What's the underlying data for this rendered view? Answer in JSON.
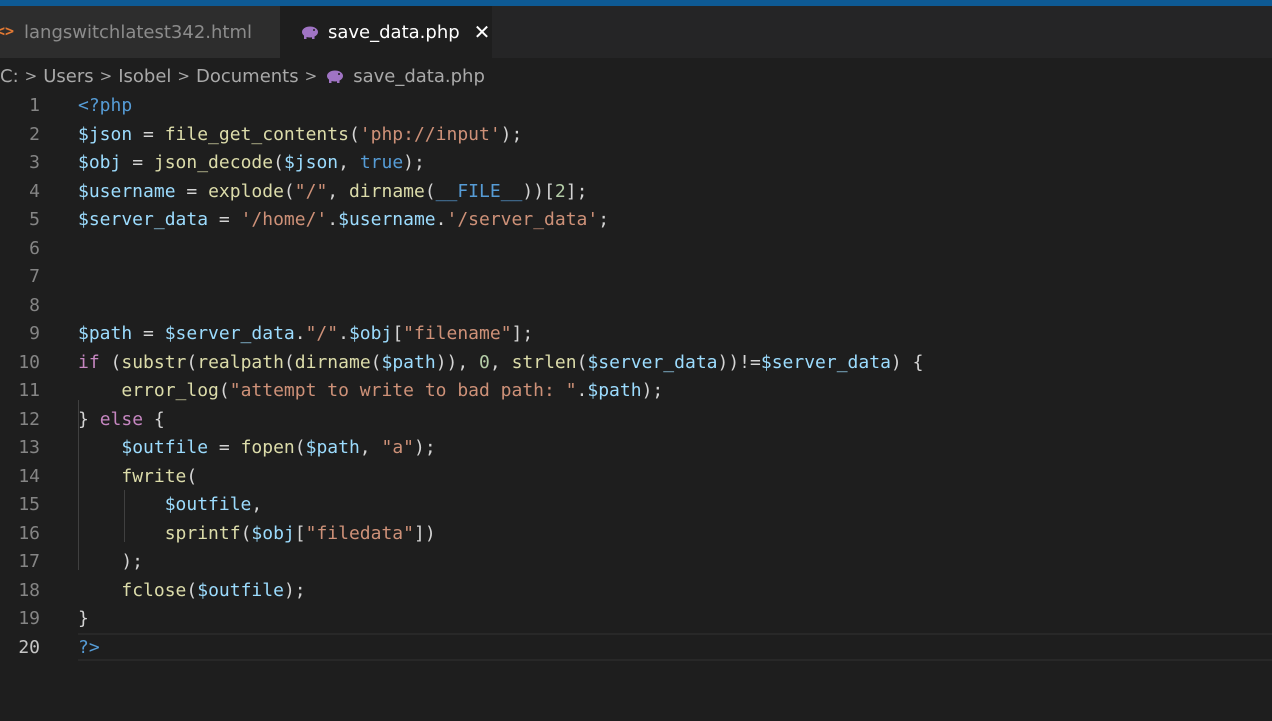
{
  "tabs": [
    {
      "label": "langswitchlatest342.html",
      "active": false,
      "icon": "html-icon"
    },
    {
      "label": "save_data.php",
      "active": true,
      "icon": "php-elephant-icon"
    }
  ],
  "breadcrumb": [
    "C:",
    "Users",
    "Isobel",
    "Documents",
    "save_data.php"
  ],
  "colors": {
    "accent": "#0e5a94",
    "variable": "#9cdcfe",
    "function": "#dcdcaa",
    "string": "#ce9178",
    "keyword": "#569cd6",
    "control": "#c586c0"
  },
  "lines": [
    {
      "n": "1",
      "tokens": [
        [
          "t",
          "<?php"
        ]
      ]
    },
    {
      "n": "2",
      "tokens": [
        [
          "v",
          "$json"
        ],
        [
          "p",
          " = "
        ],
        [
          "f",
          "file_get_contents"
        ],
        [
          "p",
          "("
        ],
        [
          "s",
          "'php://input'"
        ],
        [
          "p",
          ");"
        ]
      ]
    },
    {
      "n": "3",
      "tokens": [
        [
          "v",
          "$obj"
        ],
        [
          "p",
          " = "
        ],
        [
          "f",
          "json_decode"
        ],
        [
          "p",
          "("
        ],
        [
          "v",
          "$json"
        ],
        [
          "p",
          ", "
        ],
        [
          "k",
          "true"
        ],
        [
          "p",
          ");"
        ]
      ]
    },
    {
      "n": "4",
      "tokens": [
        [
          "v",
          "$username"
        ],
        [
          "p",
          " = "
        ],
        [
          "f",
          "explode"
        ],
        [
          "p",
          "("
        ],
        [
          "s",
          "\"/\""
        ],
        [
          "p",
          ", "
        ],
        [
          "f",
          "dirname"
        ],
        [
          "p",
          "("
        ],
        [
          "k",
          "__FILE__"
        ],
        [
          "p",
          "))["
        ],
        [
          "n",
          "2"
        ],
        [
          "p",
          "];"
        ]
      ]
    },
    {
      "n": "5",
      "tokens": [
        [
          "v",
          "$server_data"
        ],
        [
          "p",
          " = "
        ],
        [
          "s",
          "'/home/'"
        ],
        [
          "p",
          "."
        ],
        [
          "v",
          "$username"
        ],
        [
          "p",
          "."
        ],
        [
          "s",
          "'/server_data'"
        ],
        [
          "p",
          ";"
        ]
      ]
    },
    {
      "n": "6",
      "tokens": []
    },
    {
      "n": "7",
      "tokens": []
    },
    {
      "n": "8",
      "tokens": []
    },
    {
      "n": "9",
      "tokens": [
        [
          "v",
          "$path"
        ],
        [
          "p",
          " = "
        ],
        [
          "v",
          "$server_data"
        ],
        [
          "p",
          "."
        ],
        [
          "s",
          "\"/\""
        ],
        [
          "p",
          "."
        ],
        [
          "v",
          "$obj"
        ],
        [
          "p",
          "["
        ],
        [
          "s",
          "\"filename\""
        ],
        [
          "p",
          "];"
        ]
      ]
    },
    {
      "n": "10",
      "tokens": [
        [
          "c",
          "if"
        ],
        [
          "p",
          " ("
        ],
        [
          "f",
          "substr"
        ],
        [
          "p",
          "("
        ],
        [
          "f",
          "realpath"
        ],
        [
          "p",
          "("
        ],
        [
          "f",
          "dirname"
        ],
        [
          "p",
          "("
        ],
        [
          "v",
          "$path"
        ],
        [
          "p",
          ")), "
        ],
        [
          "n",
          "0"
        ],
        [
          "p",
          ", "
        ],
        [
          "f",
          "strlen"
        ],
        [
          "p",
          "("
        ],
        [
          "v",
          "$server_data"
        ],
        [
          "p",
          "))!="
        ],
        [
          "v",
          "$server_data"
        ],
        [
          "p",
          ") {"
        ]
      ]
    },
    {
      "n": "11",
      "tokens": [
        [
          "p",
          "    "
        ],
        [
          "f",
          "error_log"
        ],
        [
          "p",
          "("
        ],
        [
          "s",
          "\"attempt to write to bad path: \""
        ],
        [
          "p",
          "."
        ],
        [
          "v",
          "$path"
        ],
        [
          "p",
          ");"
        ]
      ]
    },
    {
      "n": "12",
      "tokens": [
        [
          "p",
          "} "
        ],
        [
          "c",
          "else"
        ],
        [
          "p",
          " {"
        ]
      ]
    },
    {
      "n": "13",
      "tokens": [
        [
          "p",
          "    "
        ],
        [
          "v",
          "$outfile"
        ],
        [
          "p",
          " = "
        ],
        [
          "f",
          "fopen"
        ],
        [
          "p",
          "("
        ],
        [
          "v",
          "$path"
        ],
        [
          "p",
          ", "
        ],
        [
          "s",
          "\"a\""
        ],
        [
          "p",
          ");"
        ]
      ]
    },
    {
      "n": "14",
      "tokens": [
        [
          "p",
          "    "
        ],
        [
          "f",
          "fwrite"
        ],
        [
          "p",
          "("
        ]
      ]
    },
    {
      "n": "15",
      "tokens": [
        [
          "p",
          "        "
        ],
        [
          "v",
          "$outfile"
        ],
        [
          "p",
          ","
        ]
      ]
    },
    {
      "n": "16",
      "tokens": [
        [
          "p",
          "        "
        ],
        [
          "f",
          "sprintf"
        ],
        [
          "p",
          "("
        ],
        [
          "v",
          "$obj"
        ],
        [
          "p",
          "["
        ],
        [
          "s",
          "\"filedata\""
        ],
        [
          "p",
          "])"
        ]
      ]
    },
    {
      "n": "17",
      "tokens": [
        [
          "p",
          "    );"
        ]
      ]
    },
    {
      "n": "18",
      "tokens": [
        [
          "p",
          "    "
        ],
        [
          "f",
          "fclose"
        ],
        [
          "p",
          "("
        ],
        [
          "v",
          "$outfile"
        ],
        [
          "p",
          ");"
        ]
      ]
    },
    {
      "n": "19",
      "tokens": [
        [
          "p",
          "}"
        ]
      ]
    },
    {
      "n": "20",
      "tokens": [
        [
          "t",
          "?>"
        ]
      ]
    }
  ]
}
